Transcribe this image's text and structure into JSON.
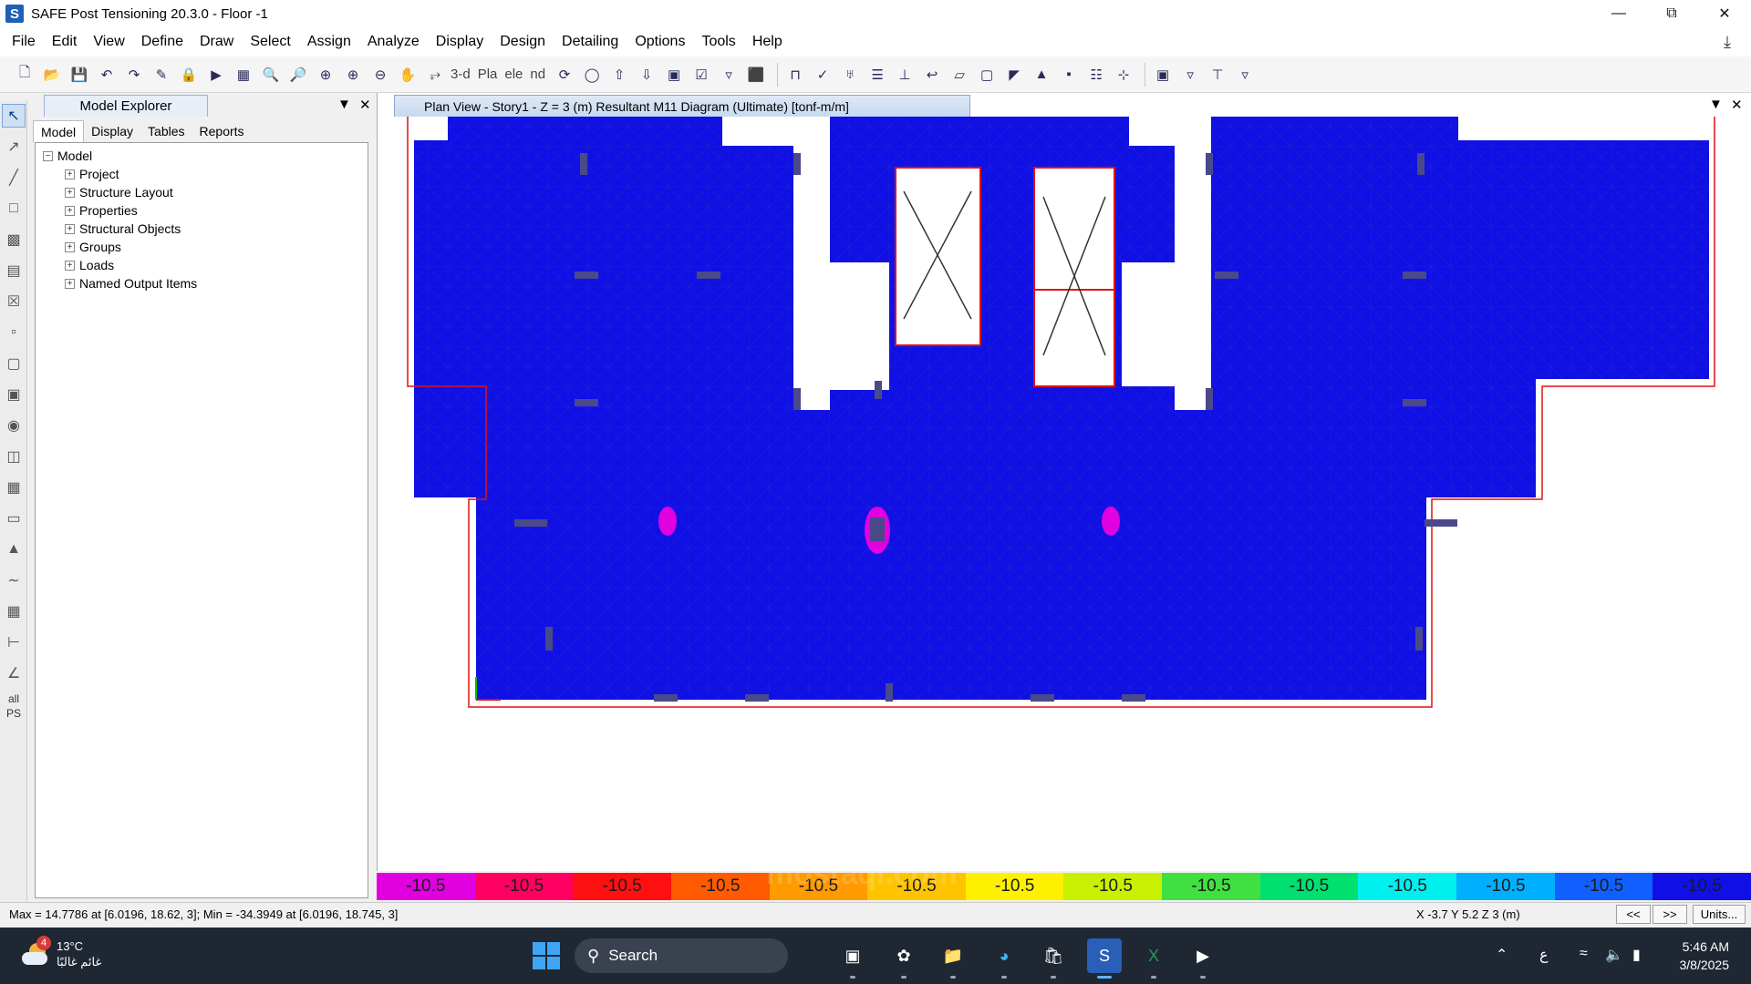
{
  "window": {
    "title": "SAFE Post Tensioning 20.3.0 - Floor -1",
    "app_icon_letter": "S",
    "minimize_icon": "minimize-icon",
    "maximize_icon": "restore-icon",
    "close_icon": "close-icon"
  },
  "menu": [
    "File",
    "Edit",
    "View",
    "Define",
    "Draw",
    "Select",
    "Assign",
    "Analyze",
    "Display",
    "Design",
    "Detailing",
    "Options",
    "Tools",
    "Help"
  ],
  "toolbar": {
    "label_3d": "3-d",
    "label_pla": "Pla",
    "label_ele": "ele",
    "label_nd": "nd"
  },
  "left_tools": {
    "all_label": "all",
    "ps_label": "PS"
  },
  "explorer": {
    "title": "Model Explorer",
    "tabs": [
      "Model",
      "Display",
      "Tables",
      "Reports"
    ],
    "root": "Model",
    "items": [
      "Project",
      "Structure Layout",
      "Properties",
      "Structural Objects",
      "Groups",
      "Loads",
      "Named Output Items"
    ]
  },
  "view": {
    "tab_title": "Plan View - Story1 - Z = 3 (m)    Resultant M11 Diagram    (Ultimate)  [tonf-m/m]",
    "fill_color": "#1010e6",
    "outline_color": "#e01010"
  },
  "legend": {
    "labels": [
      "-10.5",
      "-10.5",
      "-10.5",
      "-10.5",
      "-10.5",
      "-10.5",
      "-10.5",
      "-10.5",
      "-10.5",
      "-10.5",
      "-10.5",
      "-10.5",
      "-10.5",
      "-10.5"
    ],
    "colors": [
      "#e000e0",
      "#ff0060",
      "#ff1010",
      "#ff5a00",
      "#ff9a00",
      "#ffc400",
      "#fff000",
      "#c8f000",
      "#40e040",
      "#00e070",
      "#00f0f0",
      "#00b0ff",
      "#1060ff",
      "#1010e6"
    ]
  },
  "status": {
    "minmax": "Max = 14.7786 at [6.0196, 18.62, 3];  Min = -34.3949 at [6.0196, 18.745, 3]",
    "coords": "X -3.7  Y 5.2  Z 3 (m)",
    "prev": "<<",
    "next": ">>",
    "units": "Units..."
  },
  "taskbar": {
    "temp": "13°C",
    "weather_desc": "غائم غالبًا",
    "weather_badge": "4",
    "search": "Search",
    "lang": "ع",
    "time": "5:46 AM",
    "date": "3/8/2025"
  },
  "watermark": "mostaql.com"
}
